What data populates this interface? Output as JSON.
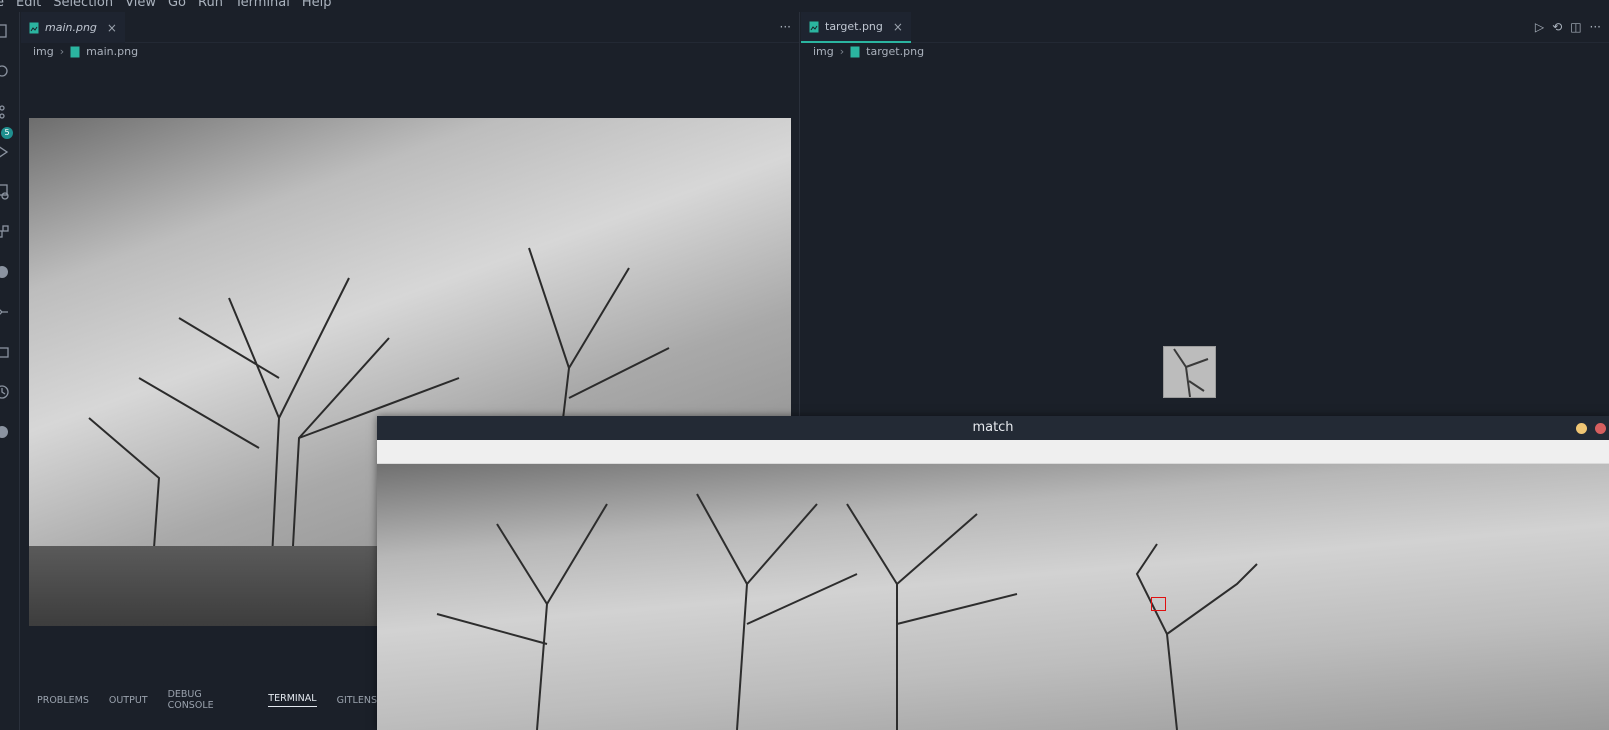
{
  "menu": [
    "e",
    "Edit",
    "Selection",
    "View",
    "Go",
    "Run",
    "Terminal",
    "Help"
  ],
  "activity_bar": {
    "icons": [
      "explorer-icon",
      "search-icon",
      "source-control-icon",
      "run-debug-icon",
      "remote-explorer-icon",
      "extensions-icon",
      "github-icon",
      "git-graph-icon",
      "folder-icon",
      "timeline-icon",
      "spotify-icon"
    ],
    "badge": "5"
  },
  "left_group": {
    "tab": {
      "label": "main.png",
      "close": "×"
    },
    "more": "···",
    "breadcrumb": {
      "folder": "img",
      "sep": "›",
      "file": "main.png"
    }
  },
  "right_group": {
    "tab": {
      "label": "target.png",
      "close": "×"
    },
    "actions": [
      "▷",
      "⟲",
      "◫",
      "···"
    ],
    "breadcrumb": {
      "folder": "img",
      "sep": "›",
      "file": "target.png"
    }
  },
  "panel": {
    "tabs": [
      "PROBLEMS",
      "OUTPUT",
      "DEBUG CONSOLE",
      "TERMINAL",
      "GITLENS"
    ],
    "active": "TERMINAL"
  },
  "match_window": {
    "title": "match",
    "buttons": {
      "minimize_color": "#f0c674",
      "close_color": "#d75f5f"
    },
    "highlight_color": "#e01010"
  },
  "colors": {
    "accent": "#2bb5a0",
    "background": "#1b2029"
  }
}
